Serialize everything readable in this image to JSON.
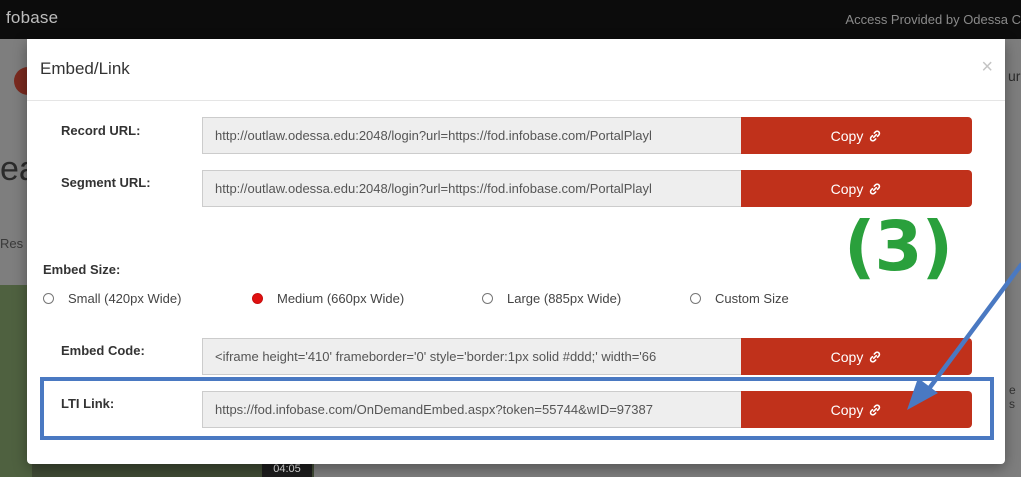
{
  "background": {
    "logo": "fobase",
    "access_text": "Access Provided by Odessa C",
    "partial_right": "ur",
    "partial_heading": "ea",
    "partial_tab": "Res",
    "partial_side": "e s",
    "video_duration": "04:05"
  },
  "modal": {
    "title": "Embed/Link",
    "close_glyph": "×",
    "record_url": {
      "label": "Record URL:",
      "value": "http://outlaw.odessa.edu:2048/login?url=https://fod.infobase.com/PortalPlayl",
      "button": "Copy"
    },
    "segment_url": {
      "label": "Segment URL:",
      "value": "http://outlaw.odessa.edu:2048/login?url=https://fod.infobase.com/PortalPlayl",
      "button": "Copy"
    },
    "embed_size": {
      "label": "Embed Size:",
      "options": [
        {
          "label": "Small (420px Wide)",
          "checked": false
        },
        {
          "label": "Medium (660px Wide)",
          "checked": true
        },
        {
          "label": "Large (885px Wide)",
          "checked": false
        },
        {
          "label": "Custom Size",
          "checked": false
        }
      ]
    },
    "embed_code": {
      "label": "Embed Code:",
      "value": "<iframe height='410' frameborder='0' style='border:1px solid #ddd;' width='66",
      "button": "Copy"
    },
    "lti_link": {
      "label": "LTI Link:",
      "value": "https://fod.infobase.com/OnDemandEmbed.aspx?token=55744&wID=97387",
      "button": "Copy"
    }
  },
  "annotation": {
    "step_label": "(3)"
  },
  "colors": {
    "copy_button": "#c0311b",
    "annotation_box": "#4a79c2",
    "annotation_text": "#2aa03c",
    "radio_selected": "#e01010"
  },
  "icons": {
    "copy": "link-icon",
    "close": "close-icon"
  }
}
